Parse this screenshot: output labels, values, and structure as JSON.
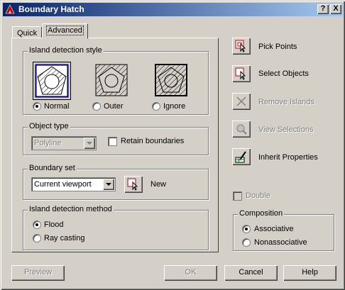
{
  "window": {
    "title": "Boundary Hatch",
    "help_btn": "?",
    "close_btn": "X"
  },
  "tabs": [
    {
      "label": "Quick"
    },
    {
      "label": "Advanced"
    }
  ],
  "island_style": {
    "legend": "Island detection style",
    "options": [
      {
        "label": "Normal",
        "selected": true
      },
      {
        "label": "Outer",
        "selected": false
      },
      {
        "label": "Ignore",
        "selected": false
      }
    ]
  },
  "object_type": {
    "legend": "Object type",
    "value": "Polyline",
    "retain_label": "Retain boundaries"
  },
  "boundary_set": {
    "legend": "Boundary set",
    "value": "Current viewport",
    "new_label": "New"
  },
  "island_method": {
    "legend": "Island detection method",
    "options": [
      {
        "label": "Flood",
        "selected": true
      },
      {
        "label": "Ray casting",
        "selected": false
      }
    ]
  },
  "actions": {
    "pick_points": "Pick Points",
    "select_objects": "Select Objects",
    "remove_islands": "Remove Islands",
    "view_selections": "View Selections",
    "inherit_properties": "Inherit Properties"
  },
  "double_label": "Double",
  "composition": {
    "legend": "Composition",
    "options": [
      {
        "label": "Associative",
        "selected": true
      },
      {
        "label": "Nonassociative",
        "selected": false
      }
    ]
  },
  "footer": {
    "preview": "Preview",
    "ok": "OK",
    "cancel": "Cancel",
    "help": "Help"
  }
}
